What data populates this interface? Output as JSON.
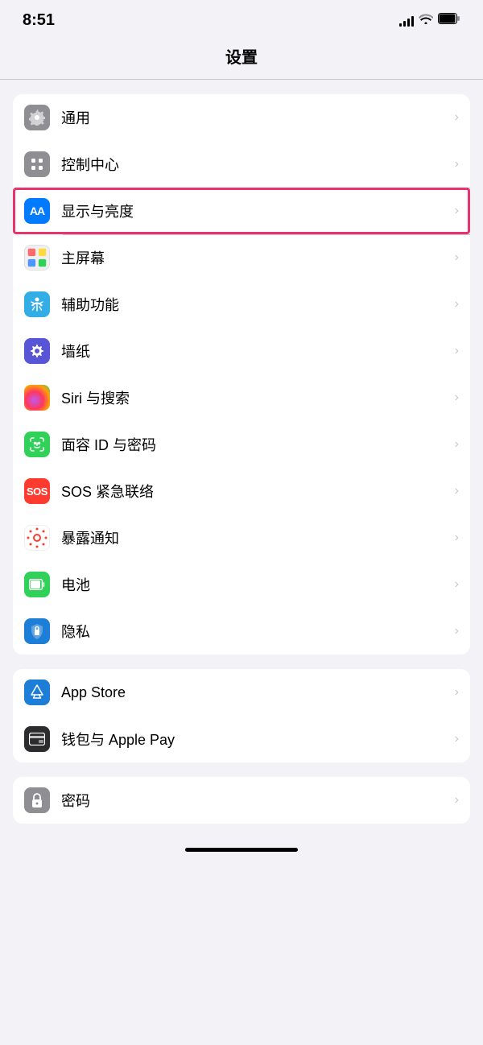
{
  "statusBar": {
    "time": "8:51"
  },
  "pageTitle": "设置",
  "groups": [
    {
      "id": "group1",
      "items": [
        {
          "id": "general",
          "label": "通用",
          "iconType": "gear",
          "iconBg": "gray",
          "highlighted": false
        },
        {
          "id": "control",
          "label": "控制中心",
          "iconType": "toggle",
          "iconBg": "gray",
          "highlighted": false
        },
        {
          "id": "display",
          "label": "显示与亮度",
          "iconType": "aa",
          "iconBg": "blue",
          "highlighted": true
        },
        {
          "id": "homescreen",
          "label": "主屏幕",
          "iconType": "grid",
          "iconBg": "grid",
          "highlighted": false
        },
        {
          "id": "accessibility",
          "label": "辅助功能",
          "iconType": "person",
          "iconBg": "teal",
          "highlighted": false
        },
        {
          "id": "wallpaper",
          "label": "墙纸",
          "iconType": "flower",
          "iconBg": "flower",
          "highlighted": false
        },
        {
          "id": "siri",
          "label": "Siri 与搜索",
          "iconType": "siri",
          "iconBg": "siri",
          "highlighted": false
        },
        {
          "id": "faceid",
          "label": "面容 ID 与密码",
          "iconType": "faceid",
          "iconBg": "faceid",
          "highlighted": false
        },
        {
          "id": "sos",
          "label": "SOS 紧急联络",
          "iconType": "sos",
          "iconBg": "sos",
          "highlighted": false
        },
        {
          "id": "exposure",
          "label": "暴露通知",
          "iconType": "exposure",
          "iconBg": "exposure",
          "highlighted": false
        },
        {
          "id": "battery",
          "label": "电池",
          "iconType": "battery",
          "iconBg": "battery",
          "highlighted": false
        },
        {
          "id": "privacy",
          "label": "隐私",
          "iconType": "privacy",
          "iconBg": "privacy",
          "highlighted": false
        }
      ]
    },
    {
      "id": "group2",
      "items": [
        {
          "id": "appstore",
          "label": "App Store",
          "iconType": "appstore",
          "iconBg": "appstore",
          "highlighted": false
        },
        {
          "id": "wallet",
          "label": "钱包与 Apple Pay",
          "iconType": "wallet",
          "iconBg": "wallet",
          "highlighted": false
        }
      ]
    },
    {
      "id": "group3",
      "items": [
        {
          "id": "password",
          "label": "密码",
          "iconType": "password",
          "iconBg": "password",
          "highlighted": false
        }
      ]
    }
  ]
}
